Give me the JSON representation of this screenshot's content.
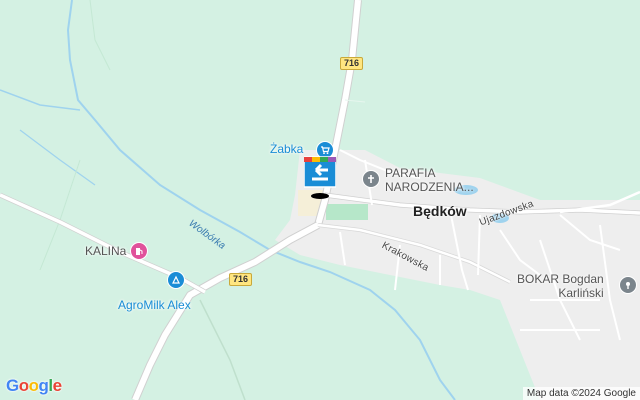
{
  "map": {
    "town_label": "Będków",
    "route_shields": [
      "716",
      "716"
    ],
    "streets": [
      "Krakowska",
      "Ujazdowska"
    ],
    "river_label": "Wolbórka",
    "pois": {
      "zabka": "Żabka",
      "parafia_line1": "PARAFIA",
      "parafia_line2": "NARODZENIA...",
      "kalina": "KALINa",
      "agromilk": "AgroMilk Alex",
      "bokar_line1": "BOKAR Bogdan",
      "bokar_line2": "Karliński"
    },
    "logo": {
      "letters": [
        "G",
        "o",
        "o",
        "g",
        "l",
        "e"
      ],
      "colors": [
        "#4285F4",
        "#EA4335",
        "#FBBC05",
        "#4285F4",
        "#34A853",
        "#EA4335"
      ]
    },
    "attribution": "Map data ©2024 Google"
  },
  "colors": {
    "background": "#d4f1e3",
    "settlement": "#eeeeee",
    "road": "#ffffff",
    "river": "#9fd3ee",
    "shield": "#ffe680"
  },
  "icons": [
    "shopping-cart-icon",
    "church-icon",
    "gas-station-icon",
    "dairy-store-icon",
    "company-icon",
    "location-marker-icon"
  ]
}
